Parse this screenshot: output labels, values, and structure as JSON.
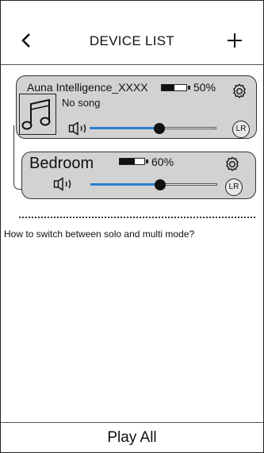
{
  "header": {
    "title": "DEVICE LIST",
    "back_icon": "chevron-left-icon",
    "add_icon": "plus-icon"
  },
  "devices": [
    {
      "name": "Auna Intelligence_XXXX",
      "now_playing": "No song",
      "battery_percent": 50,
      "battery_label": "50%",
      "volume": 0.55,
      "channel_label": "LR",
      "grouped": true,
      "cover_icon": "music-note-icon"
    },
    {
      "name": "Bedroom",
      "battery_percent": 60,
      "battery_label": "60%",
      "volume": 0.55,
      "channel_label": "LR",
      "grouped": true
    }
  ],
  "help": {
    "text": "How to switch between solo and multi mode?"
  },
  "footer": {
    "play_all_label": "Play All"
  },
  "colors": {
    "card_bg": "#d2d2d2",
    "volume_fill": "#2a7fd0",
    "text": "#111111"
  }
}
